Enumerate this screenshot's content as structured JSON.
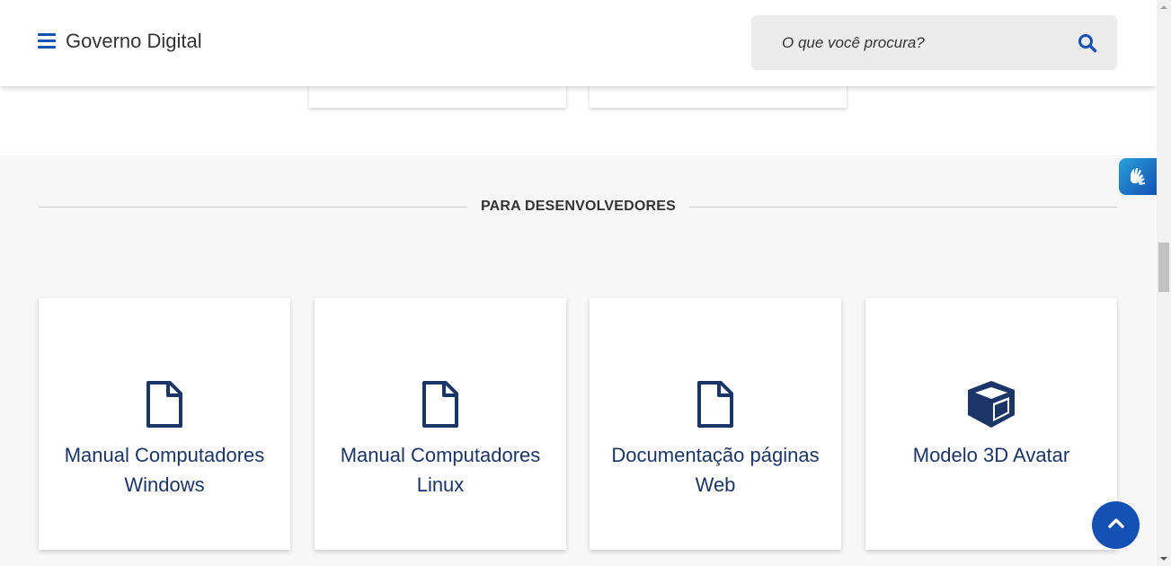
{
  "header": {
    "site_title": "Governo Digital",
    "menu_icon": "hamburger-icon",
    "search": {
      "placeholder": "O que você procura?",
      "icon": "search-icon"
    }
  },
  "dev_section": {
    "title": "PARA DESENVOLVEDORES",
    "cards": [
      {
        "label": "Manual Computadores Windows",
        "icon": "file-icon"
      },
      {
        "label": "Manual Computadores Linux",
        "icon": "file-icon"
      },
      {
        "label": "Documentação páginas Web",
        "icon": "file-icon"
      },
      {
        "label": "Modelo 3D Avatar",
        "icon": "cube-icon"
      }
    ]
  },
  "widgets": {
    "vlibras_icon": "sign-language-hands-icon",
    "back_to_top_icon": "chevron-up-icon"
  },
  "colors": {
    "brand_blue": "#1351b4",
    "card_text": "#1b3566",
    "icon_dark": "#1b3566",
    "section_bg": "#f7f7f7",
    "search_bg": "#ececec"
  }
}
